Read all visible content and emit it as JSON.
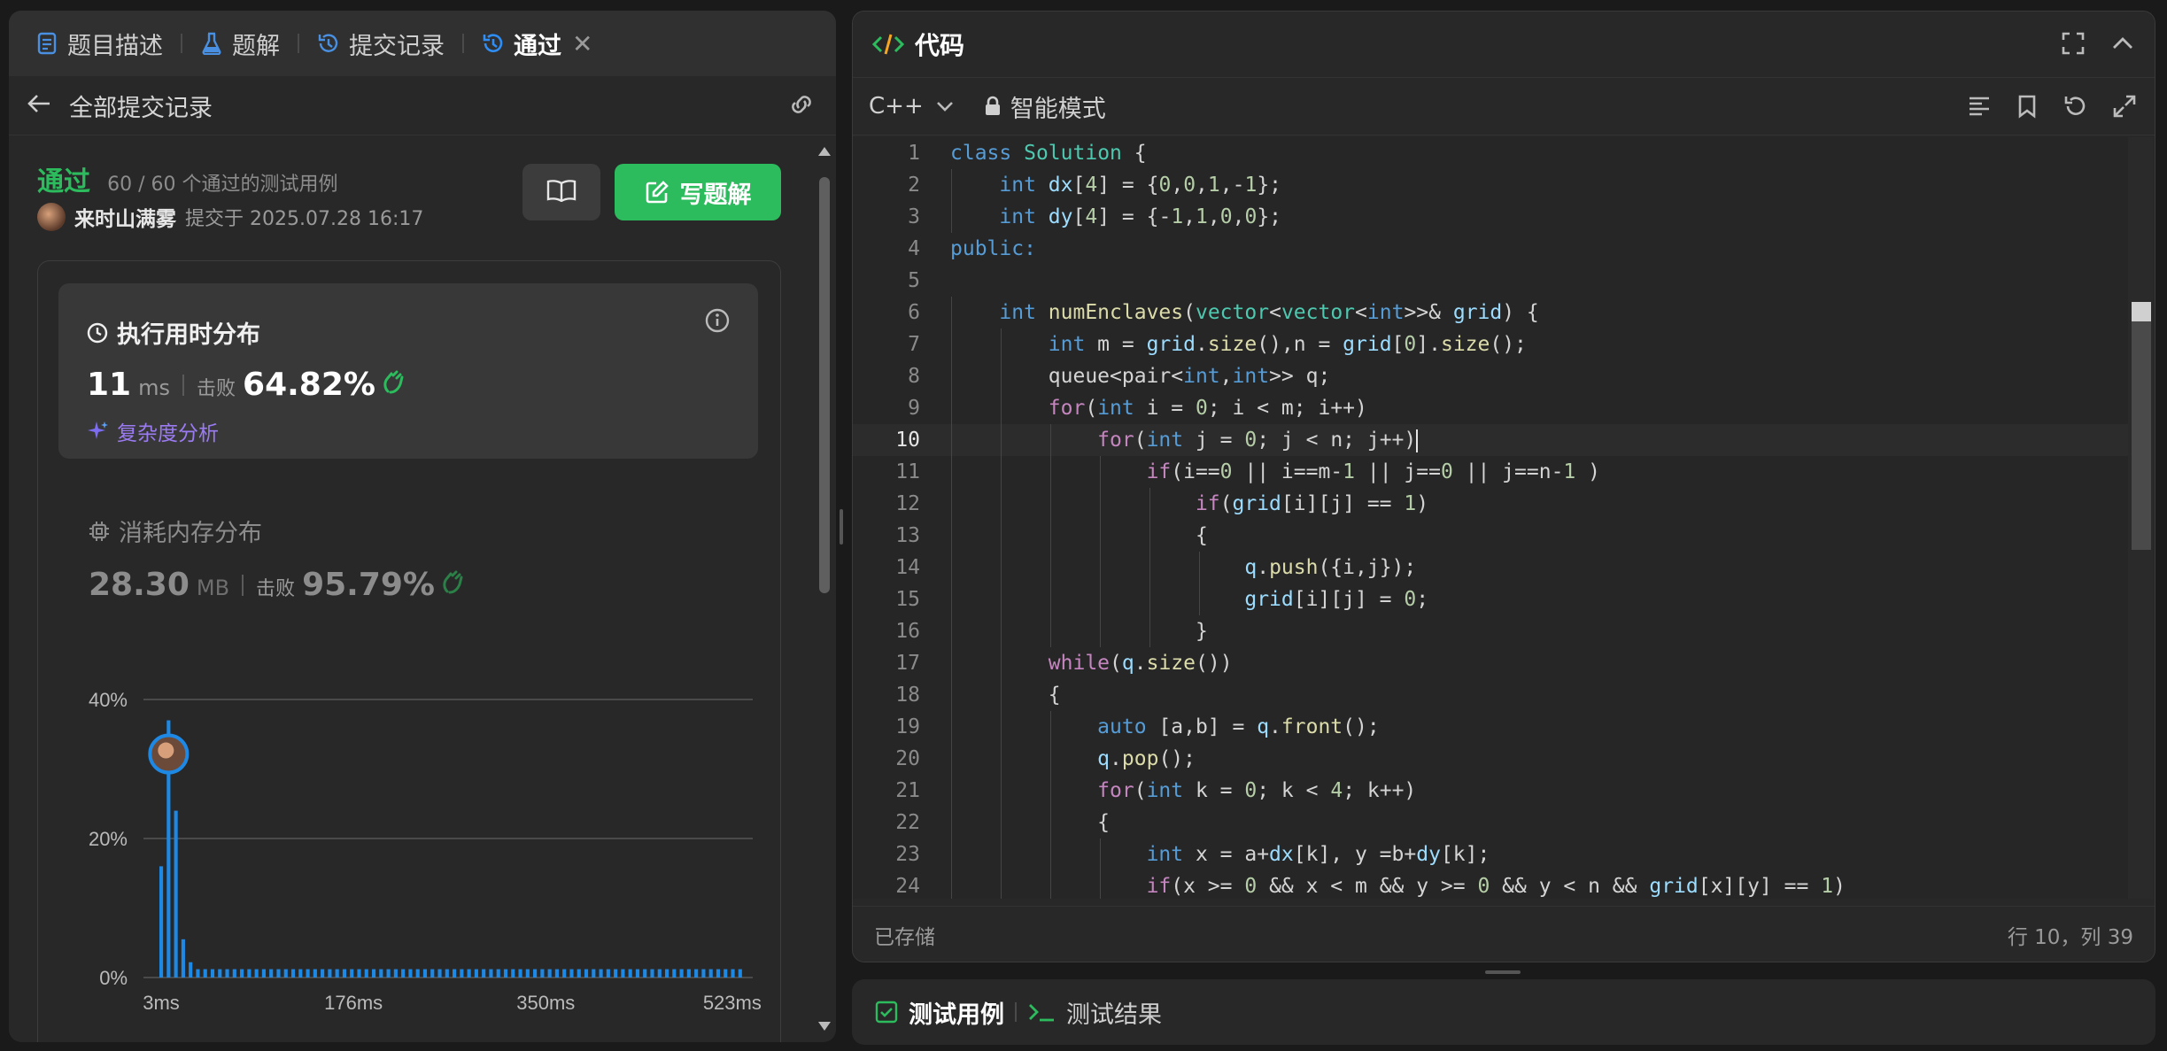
{
  "left_tabs": [
    {
      "label": "题目描述",
      "icon": "document-icon"
    },
    {
      "label": "题解",
      "icon": "flask-icon"
    },
    {
      "label": "提交记录",
      "icon": "history-icon"
    },
    {
      "label": "通过",
      "icon": "history-icon",
      "active": true
    }
  ],
  "subheader": {
    "title": "全部提交记录"
  },
  "submission": {
    "status": "通过",
    "cases": "60 / 60 个通过的测试用例",
    "user": "来时山满雾",
    "submitted": "提交于 2025.07.28 16:17",
    "write_button": "写题解"
  },
  "runtime": {
    "title": "执行用时分布",
    "value": "11",
    "unit": "ms",
    "beat_label": "击败",
    "beat": "64.82%",
    "complexity": "复杂度分析"
  },
  "memory": {
    "title": "消耗内存分布",
    "value": "28.30",
    "unit": "MB",
    "beat_label": "击败",
    "beat": "95.79%"
  },
  "chart_data": {
    "type": "bar",
    "title": "",
    "xlabel": "",
    "ylabel": "",
    "y_ticks": [
      "40%",
      "20%",
      "0%"
    ],
    "x_ticks": [
      "3ms",
      "176ms",
      "350ms",
      "523ms"
    ],
    "ylim": [
      0,
      40
    ],
    "values": [
      16,
      37,
      24,
      5.5,
      2.2,
      1.2,
      1.2,
      1.2,
      1.2,
      1.2,
      1.2,
      1.2,
      1.2,
      1.2,
      1.2,
      1.2,
      1.2,
      1.2,
      1.2,
      1.2,
      1.2,
      1.2,
      1.2,
      1.2,
      1.2,
      1.2,
      1.2,
      1.2,
      1.2,
      1.2,
      1.2,
      1.2,
      1.2,
      1.2,
      1.2,
      1.2,
      1.2,
      1.2,
      1.2,
      1.2,
      1.2,
      1.2,
      1.2,
      1.2,
      1.2,
      1.2,
      1.2,
      1.2,
      1.2,
      1.2,
      1.2,
      1.2,
      1.2,
      1.2,
      1.2,
      1.2,
      1.2,
      1.2,
      1.2,
      1.2,
      1.2,
      1.2,
      1.2,
      1.2,
      1.2,
      1.2,
      1.2,
      1.2,
      1.2,
      1.2,
      1.2,
      1.2,
      1.2,
      1.2,
      1.2,
      1.2,
      1.2,
      1.2,
      1.2,
      1.2
    ],
    "highlight_index": 1,
    "bar_color": "#1e88e5"
  },
  "editor": {
    "title": "代码",
    "language": "C++",
    "mode": "智能模式",
    "saved": "已存储",
    "cursor": "行 10，列 39",
    "current_line": 10
  },
  "code_lines": [
    [
      [
        "kw",
        "class"
      ],
      [
        "op",
        " "
      ],
      [
        "ty",
        "Solution"
      ],
      [
        "op",
        " {"
      ]
    ],
    [
      [
        "op",
        "    "
      ],
      [
        "kw",
        "int"
      ],
      [
        "op",
        " "
      ],
      [
        "va",
        "dx"
      ],
      [
        "op",
        "["
      ],
      [
        "nm",
        "4"
      ],
      [
        "op",
        "] = {"
      ],
      [
        "nm",
        "0"
      ],
      [
        "op",
        ","
      ],
      [
        "nm",
        "0"
      ],
      [
        "op",
        ","
      ],
      [
        "nm",
        "1"
      ],
      [
        "op",
        ",-"
      ],
      [
        "nm",
        "1"
      ],
      [
        "op",
        "};"
      ]
    ],
    [
      [
        "op",
        "    "
      ],
      [
        "kw",
        "int"
      ],
      [
        "op",
        " "
      ],
      [
        "va",
        "dy"
      ],
      [
        "op",
        "["
      ],
      [
        "nm",
        "4"
      ],
      [
        "op",
        "] = {-"
      ],
      [
        "nm",
        "1"
      ],
      [
        "op",
        ","
      ],
      [
        "nm",
        "1"
      ],
      [
        "op",
        ","
      ],
      [
        "nm",
        "0"
      ],
      [
        "op",
        ","
      ],
      [
        "nm",
        "0"
      ],
      [
        "op",
        "};"
      ]
    ],
    [
      [
        "kw",
        "public:"
      ]
    ],
    [
      [
        "op",
        ""
      ]
    ],
    [
      [
        "op",
        "    "
      ],
      [
        "kw",
        "int"
      ],
      [
        "op",
        " "
      ],
      [
        "fn",
        "numEnclaves"
      ],
      [
        "op",
        "("
      ],
      [
        "ty",
        "vector"
      ],
      [
        "op",
        "<"
      ],
      [
        "ty",
        "vector"
      ],
      [
        "op",
        "<"
      ],
      [
        "kw",
        "int"
      ],
      [
        "op",
        ">>"
      ],
      [
        "op",
        "& "
      ],
      [
        "va",
        "grid"
      ],
      [
        "op",
        ") {"
      ]
    ],
    [
      [
        "op",
        "        "
      ],
      [
        "kw",
        "int"
      ],
      [
        "op",
        " m = "
      ],
      [
        "va",
        "grid"
      ],
      [
        "op",
        "."
      ],
      [
        "fn",
        "size"
      ],
      [
        "op",
        "(),n = "
      ],
      [
        "va",
        "grid"
      ],
      [
        "op",
        "["
      ],
      [
        "nm",
        "0"
      ],
      [
        "op",
        "]."
      ],
      [
        "fn",
        "size"
      ],
      [
        "op",
        "();"
      ]
    ],
    [
      [
        "op",
        "        queue<pair<"
      ],
      [
        "kw",
        "int"
      ],
      [
        "op",
        ","
      ],
      [
        "kw",
        "int"
      ],
      [
        "op",
        ">> q;"
      ]
    ],
    [
      [
        "op",
        "        "
      ],
      [
        "kw2",
        "for"
      ],
      [
        "op",
        "("
      ],
      [
        "kw",
        "int"
      ],
      [
        "op",
        " i = "
      ],
      [
        "nm",
        "0"
      ],
      [
        "op",
        "; i < m; i++)"
      ]
    ],
    [
      [
        "op",
        "            "
      ],
      [
        "kw2",
        "for"
      ],
      [
        "op",
        "("
      ],
      [
        "kw",
        "int"
      ],
      [
        "op",
        " j = "
      ],
      [
        "nm",
        "0"
      ],
      [
        "op",
        "; j < n; j++)"
      ]
    ],
    [
      [
        "op",
        "                "
      ],
      [
        "kw2",
        "if"
      ],
      [
        "op",
        "(i=="
      ],
      [
        "nm",
        "0"
      ],
      [
        "op",
        " || i==m-"
      ],
      [
        "nm",
        "1"
      ],
      [
        "op",
        " || j=="
      ],
      [
        "nm",
        "0"
      ],
      [
        "op",
        " || j==n-"
      ],
      [
        "nm",
        "1"
      ],
      [
        "op",
        " )"
      ]
    ],
    [
      [
        "op",
        "                    "
      ],
      [
        "kw2",
        "if"
      ],
      [
        "op",
        "("
      ],
      [
        "va",
        "grid"
      ],
      [
        "op",
        "[i][j] == "
      ],
      [
        "nm",
        "1"
      ],
      [
        "op",
        ")"
      ]
    ],
    [
      [
        "op",
        "                    {"
      ]
    ],
    [
      [
        "op",
        "                        "
      ],
      [
        "va",
        "q"
      ],
      [
        "op",
        "."
      ],
      [
        "fn",
        "push"
      ],
      [
        "op",
        "({i,j});"
      ]
    ],
    [
      [
        "op",
        "                        "
      ],
      [
        "va",
        "grid"
      ],
      [
        "op",
        "[i][j] = "
      ],
      [
        "nm",
        "0"
      ],
      [
        "op",
        ";"
      ]
    ],
    [
      [
        "op",
        "                    }"
      ]
    ],
    [
      [
        "op",
        "        "
      ],
      [
        "kw2",
        "while"
      ],
      [
        "op",
        "("
      ],
      [
        "va",
        "q"
      ],
      [
        "op",
        "."
      ],
      [
        "fn",
        "size"
      ],
      [
        "op",
        "())"
      ]
    ],
    [
      [
        "op",
        "        {"
      ]
    ],
    [
      [
        "op",
        "            "
      ],
      [
        "kw",
        "auto"
      ],
      [
        "op",
        " [a,b] = "
      ],
      [
        "va",
        "q"
      ],
      [
        "op",
        "."
      ],
      [
        "fn",
        "front"
      ],
      [
        "op",
        "();"
      ]
    ],
    [
      [
        "op",
        "            "
      ],
      [
        "va",
        "q"
      ],
      [
        "op",
        "."
      ],
      [
        "fn",
        "pop"
      ],
      [
        "op",
        "();"
      ]
    ],
    [
      [
        "op",
        "            "
      ],
      [
        "kw2",
        "for"
      ],
      [
        "op",
        "("
      ],
      [
        "kw",
        "int"
      ],
      [
        "op",
        " k = "
      ],
      [
        "nm",
        "0"
      ],
      [
        "op",
        "; k < "
      ],
      [
        "nm",
        "4"
      ],
      [
        "op",
        "; k++)"
      ]
    ],
    [
      [
        "op",
        "            {"
      ]
    ],
    [
      [
        "op",
        "                "
      ],
      [
        "kw",
        "int"
      ],
      [
        "op",
        " x = a+"
      ],
      [
        "va",
        "dx"
      ],
      [
        "op",
        "[k], y =b+"
      ],
      [
        "va",
        "dy"
      ],
      [
        "op",
        "[k];"
      ]
    ],
    [
      [
        "op",
        "                "
      ],
      [
        "kw2",
        "if"
      ],
      [
        "op",
        "(x >= "
      ],
      [
        "nm",
        "0"
      ],
      [
        "op",
        " && x < m && y >= "
      ],
      [
        "nm",
        "0"
      ],
      [
        "op",
        " && y < n && "
      ],
      [
        "va",
        "grid"
      ],
      [
        "op",
        "[x][y] == "
      ],
      [
        "nm",
        "1"
      ],
      [
        "op",
        ")"
      ]
    ]
  ],
  "bottom_tabs": [
    {
      "label": "测试用例",
      "icon": "checkbox-icon"
    },
    {
      "label": "测试结果",
      "icon": "terminal-icon"
    }
  ]
}
